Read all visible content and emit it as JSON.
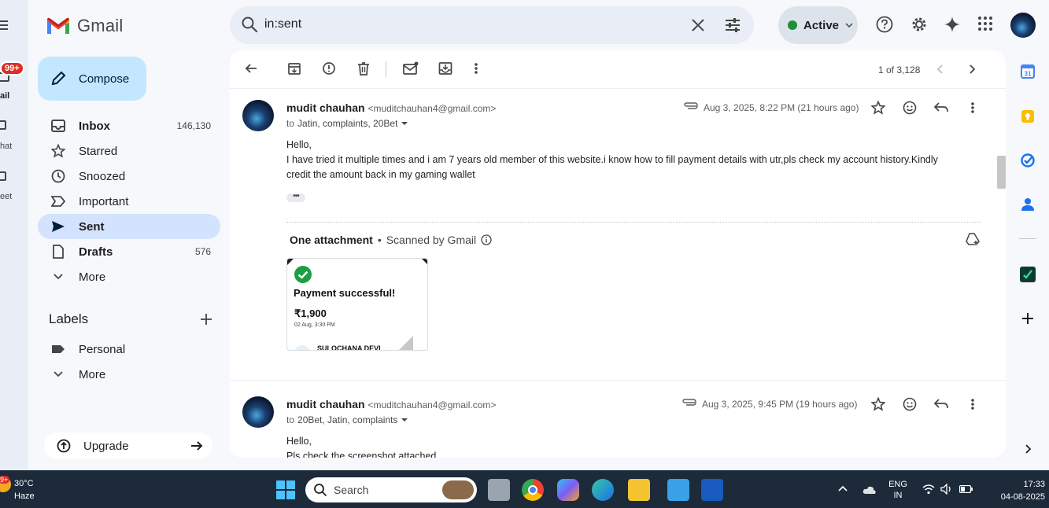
{
  "app": {
    "name": "Gmail"
  },
  "rail": {
    "badge": "99+",
    "labels": [
      "ail",
      "hat",
      "eet"
    ]
  },
  "search": {
    "query": "in:sent"
  },
  "status": {
    "label": "Active",
    "color": "#1e8e3e"
  },
  "sidebar": {
    "compose_label": "Compose",
    "items": [
      {
        "label": "Inbox",
        "count": "146,130"
      },
      {
        "label": "Starred",
        "count": ""
      },
      {
        "label": "Snoozed",
        "count": ""
      },
      {
        "label": "Important",
        "count": ""
      },
      {
        "label": "Sent",
        "count": ""
      },
      {
        "label": "Drafts",
        "count": "576"
      },
      {
        "label": "More",
        "count": ""
      }
    ],
    "labels_heading": "Labels",
    "labels": [
      {
        "label": "Personal"
      },
      {
        "label": "More"
      }
    ],
    "upgrade_label": "Upgrade"
  },
  "toolbar": {
    "pager": "1 of 3,128"
  },
  "messages": [
    {
      "sender": "mudit chauhan",
      "email": "<muditchauhan4@gmail.com>",
      "to_prefix": "to",
      "to": "Jatin, complaints, 20Bet",
      "date": "Aug 3, 2025, 8:22 PM (21 hours ago)",
      "body": [
        "Hello,",
        "I have tried it multiple times and i am 7 years old member of this website.i know how to fill payment details with utr,pls check my account history.Kindly",
        "credit the amount back in my gaming wallet"
      ],
      "attachment_heading": "One attachment",
      "attachment_note": "Scanned by Gmail",
      "attachment_preview": {
        "title": "Payment successful!",
        "amount": "₹1,900",
        "time": "02 Aug, 3:30 PM",
        "name": "SULOCHANA DEVI"
      }
    },
    {
      "sender": "mudit chauhan",
      "email": "<muditchauhan4@gmail.com>",
      "to_prefix": "to",
      "to": "20Bet, Jatin, complaints",
      "date": "Aug 3, 2025, 9:45 PM (19 hours ago)",
      "body": [
        "Hello,",
        "Pls check the screenshot attached"
      ]
    }
  ],
  "taskbar": {
    "badge": "9+",
    "weather_temp": "30°C",
    "weather_desc": "Haze",
    "search_placeholder": "Search",
    "lang": "ENG",
    "region": "IN",
    "time": "17:33",
    "date": "04-08-2025"
  },
  "colors": {
    "compose_bg": "#c2e7ff",
    "active_nav_bg": "#d3e3fd",
    "app_bg": "#f6f8fc"
  },
  "icons": [
    "menu-icon",
    "gmail-logo-icon",
    "search-icon",
    "clear-icon",
    "filter-options-icon",
    "help-icon",
    "settings-icon",
    "gemini-icon",
    "apps-icon",
    "pencil-icon",
    "inbox-icon",
    "star-icon",
    "clock-icon",
    "important-icon",
    "send-icon",
    "draft-icon",
    "chevron-down-icon",
    "plus-icon",
    "label-icon",
    "upgrade-icon",
    "arrow-right-icon",
    "back-icon",
    "archive-icon",
    "report-spam-icon",
    "delete-icon",
    "mark-unread-icon",
    "move-to-icon",
    "more-vert-icon",
    "chevron-left-icon",
    "chevron-right-icon",
    "attachment-icon",
    "emoji-icon",
    "reply-icon",
    "info-icon",
    "add-to-drive-icon",
    "check-circle-icon",
    "calendar-icon",
    "keep-icon",
    "tasks-icon",
    "contacts-icon",
    "windows-icon",
    "wifi-icon",
    "volume-icon",
    "battery-icon",
    "cloud-icon"
  ]
}
